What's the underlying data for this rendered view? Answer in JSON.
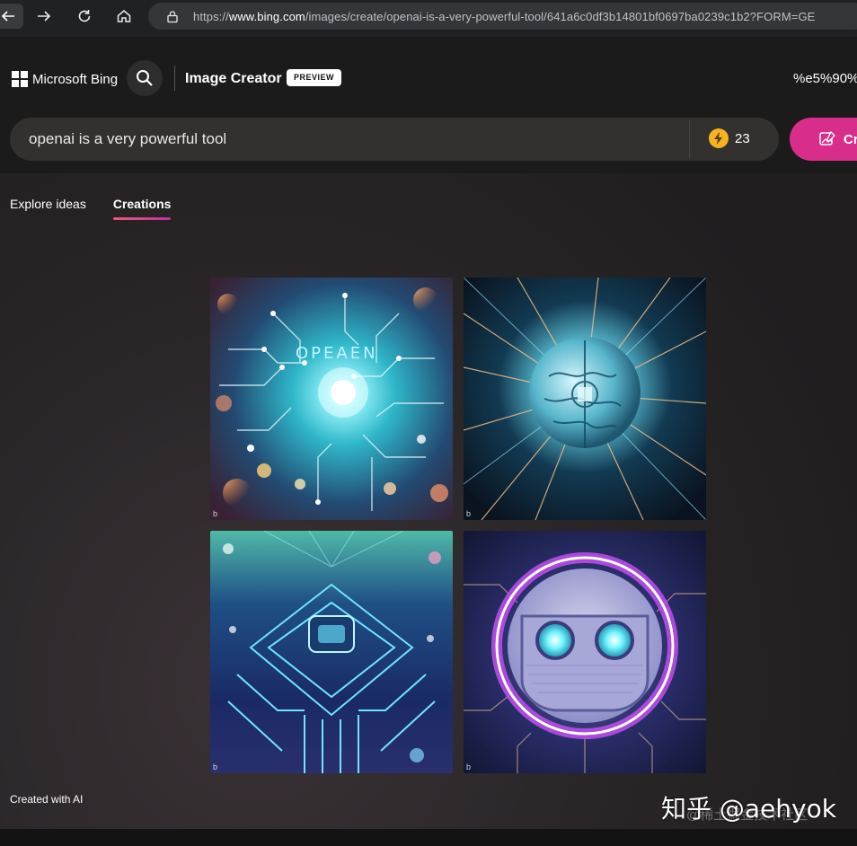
{
  "browser": {
    "url_prefix": "https://",
    "url_host": "www.bing.com",
    "url_path": "/images/create/openai-is-a-very-powerful-tool/641a6c0df3b14801bf0697ba0239c1b2?FORM=GE"
  },
  "header": {
    "brand": "Microsoft Bing",
    "title": "Image Creator",
    "badge": "PREVIEW",
    "user": "%e5%90%"
  },
  "prompt": {
    "value": "openai is a very powerful tool",
    "boosts": "23",
    "create_label": "Cr"
  },
  "tabs": [
    {
      "label": "Explore ideas"
    },
    {
      "label": "Creations"
    }
  ],
  "images": [
    {
      "text": "OPEAEN",
      "watermark": "b"
    },
    {
      "watermark": "b"
    },
    {
      "watermark": "b"
    },
    {
      "watermark": "b"
    }
  ],
  "footer": {
    "note": "Created with AI",
    "watermark": "知乎 @aehyok",
    "watermark_sub": "@稀土掘金技术社区"
  },
  "colors": {
    "accent": "#d92d8c",
    "boost": "#f4b323",
    "tab_underline": "#f0597a"
  }
}
